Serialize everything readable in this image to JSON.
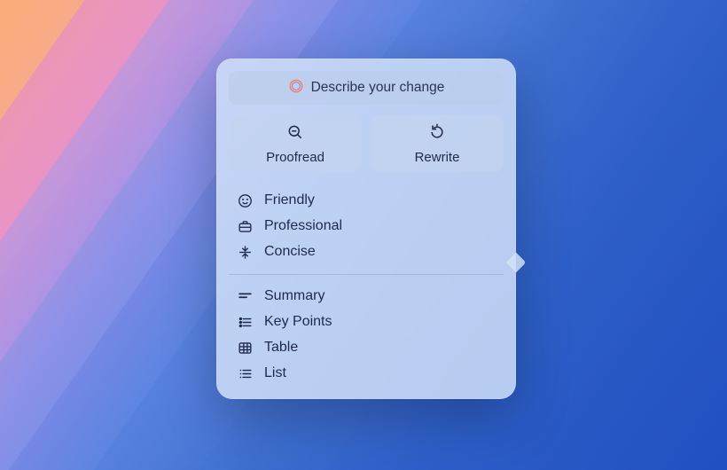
{
  "input": {
    "placeholder": "Describe your change"
  },
  "buttons": {
    "proofread": "Proofread",
    "rewrite": "Rewrite"
  },
  "tone_items": [
    {
      "label": "Friendly"
    },
    {
      "label": "Professional"
    },
    {
      "label": "Concise"
    }
  ],
  "format_items": [
    {
      "label": "Summary"
    },
    {
      "label": "Key Points"
    },
    {
      "label": "Table"
    },
    {
      "label": "List"
    }
  ]
}
